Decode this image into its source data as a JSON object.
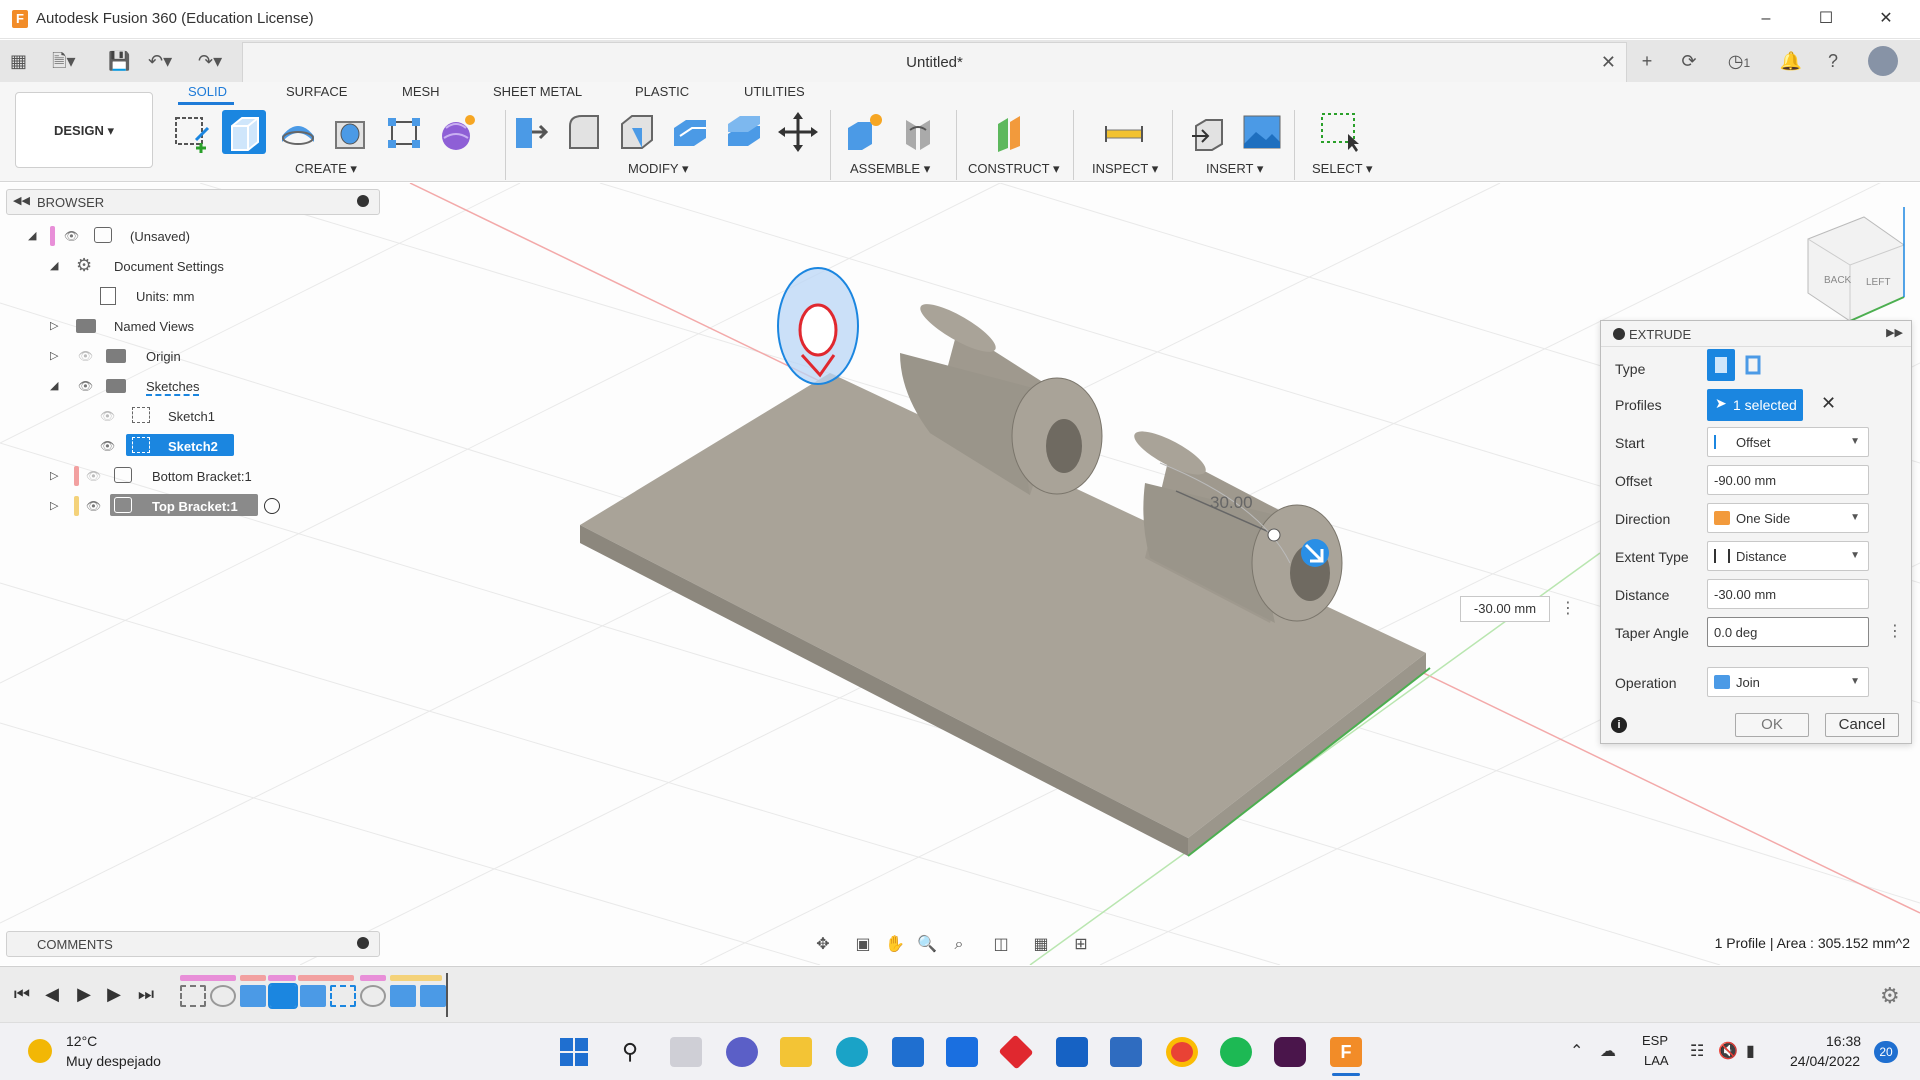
{
  "window": {
    "title": "Autodesk Fusion 360 (Education License)"
  },
  "document": {
    "tab_title": "Untitled*"
  },
  "quick_access": {
    "job_count": "1"
  },
  "workspace": {
    "label": "DESIGN"
  },
  "ribbon": {
    "tabs": [
      {
        "label": "SOLID"
      },
      {
        "label": "SURFACE"
      },
      {
        "label": "MESH"
      },
      {
        "label": "SHEET METAL"
      },
      {
        "label": "PLASTIC"
      },
      {
        "label": "UTILITIES"
      }
    ],
    "groups": {
      "create": "CREATE",
      "modify": "MODIFY",
      "assemble": "ASSEMBLE",
      "construct": "CONSTRUCT",
      "inspect": "INSPECT",
      "insert": "INSERT",
      "select": "SELECT"
    }
  },
  "browser": {
    "title": "BROWSER",
    "items": [
      {
        "label": "(Unsaved)"
      },
      {
        "label": "Document Settings"
      },
      {
        "label": "Units: mm"
      },
      {
        "label": "Named Views"
      },
      {
        "label": "Origin"
      },
      {
        "label": "Sketches"
      },
      {
        "label": "Sketch1"
      },
      {
        "label": "Sketch2"
      },
      {
        "label": "Bottom Bracket:1"
      },
      {
        "label": "Top Bracket:1"
      }
    ]
  },
  "viewport": {
    "angle_label": "30.00",
    "distance_readout": "-30.00 mm",
    "viewcube_faces": [
      "BACK",
      "LEFT"
    ]
  },
  "extrude": {
    "title": "EXTRUDE",
    "labels": {
      "type": "Type",
      "profiles": "Profiles",
      "start": "Start",
      "offset": "Offset",
      "direction": "Direction",
      "extent_type": "Extent Type",
      "distance": "Distance",
      "taper_angle": "Taper Angle",
      "operation": "Operation"
    },
    "values": {
      "profiles": "1 selected",
      "start": "Offset",
      "offset": "-90.00 mm",
      "direction": "One Side",
      "extent_type": "Distance",
      "distance": "-30.00 mm",
      "taper_angle": "0.0 deg",
      "operation": "Join"
    },
    "ok": "OK",
    "cancel": "Cancel"
  },
  "comments": {
    "title": "COMMENTS"
  },
  "status": {
    "text": "1 Profile | Area : 305.152 mm^2"
  },
  "taskbar": {
    "weather_temp": "12°C",
    "weather_desc": "Muy despejado",
    "lang1": "ESP",
    "lang2": "LAA",
    "time": "16:38",
    "date": "24/04/2022",
    "notifications": "20"
  },
  "colors": {
    "accent": "#1b86e0",
    "body": "#a9a398"
  }
}
